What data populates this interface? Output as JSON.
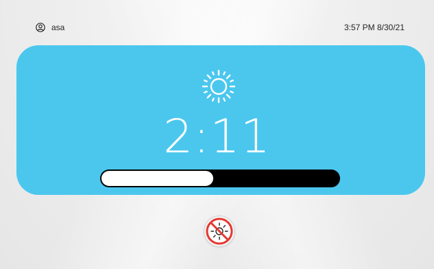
{
  "user": {
    "name": "asa",
    "icon": "user-circle-icon"
  },
  "status": {
    "datetime": "3:57 PM 8/30/21"
  },
  "timer": {
    "icon": "sun-icon",
    "remaining": "2:11",
    "progress_fraction": 0.47
  },
  "actions": {
    "cancel_icon": "no-uv-light-icon"
  },
  "colors": {
    "card": "#4bc7ee",
    "progress_track": "#000000",
    "progress_fill": "#ffffff",
    "cancel_accent": "#e5372f"
  }
}
